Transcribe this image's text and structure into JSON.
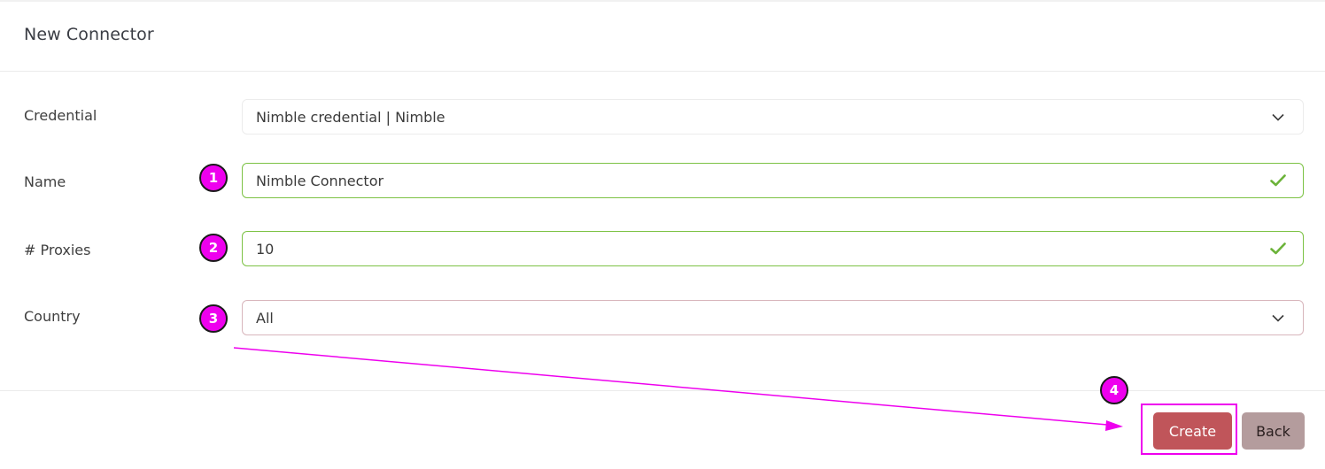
{
  "card": {
    "title": "New Connector"
  },
  "form": {
    "credential": {
      "label": "Credential",
      "value": "Nimble credential | Nimble",
      "icon": "chevron-down-icon"
    },
    "name": {
      "label": "Name",
      "value": "Nimble Connector",
      "icon": "check-icon"
    },
    "proxies": {
      "label": "# Proxies",
      "value": "10",
      "icon": "check-icon"
    },
    "country": {
      "label": "Country",
      "value": "All",
      "icon": "chevron-down-icon"
    }
  },
  "actions": {
    "create_label": "Create",
    "back_label": "Back"
  },
  "annotations": {
    "markers": [
      "1",
      "2",
      "3",
      "4"
    ],
    "color": "#ee00ee"
  },
  "colors": {
    "valid_border": "#7cc244",
    "create_button": "#c0555a",
    "back_button": "#b49c9d"
  }
}
